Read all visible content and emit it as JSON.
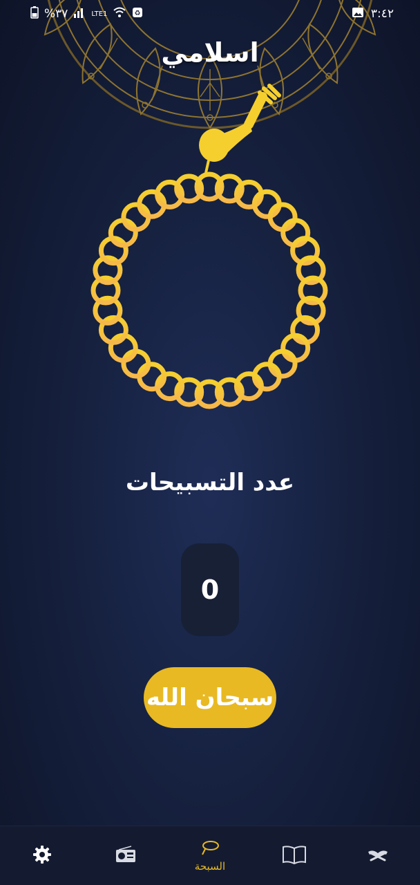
{
  "status_bar": {
    "time": "٣:٤٢",
    "battery": "%٣٧",
    "network": "LTE1"
  },
  "app": {
    "title": "اسلامي"
  },
  "main": {
    "count_label": "عدد التسبيحات",
    "count_value": "0",
    "tasbeeh_button_label": "سبحان الله"
  },
  "bottom_nav": {
    "active_label": "السبحة",
    "items": [
      {
        "icon": "gear-icon"
      },
      {
        "icon": "radio-icon"
      },
      {
        "icon": "tasbeeh-icon"
      },
      {
        "icon": "book-icon"
      },
      {
        "icon": "quran-icon"
      }
    ]
  },
  "colors": {
    "accent": "#e8b923",
    "background": "#16213f",
    "nav_background": "#141b31"
  }
}
